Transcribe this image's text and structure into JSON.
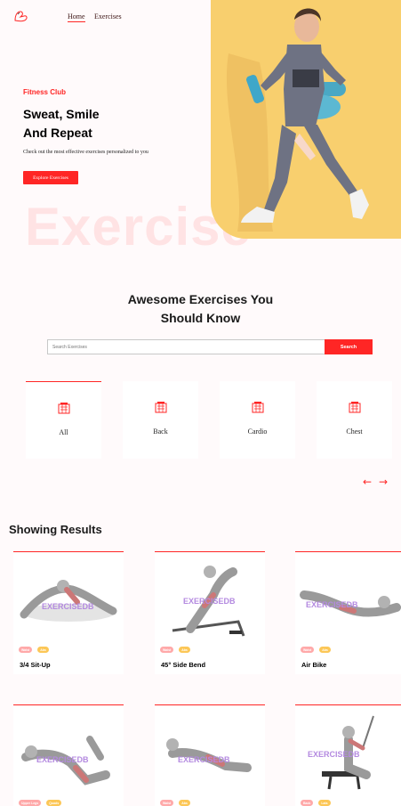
{
  "nav": {
    "home": "Home",
    "exercises": "Exercises"
  },
  "hero": {
    "tag": "Fitness Club",
    "title_line1": "Sweat, Smile",
    "title_line2": "And Repeat",
    "subtitle": "Check out the most effective exercises personalized to you",
    "button": "Explore Exercises",
    "watermark": "Exercise"
  },
  "search": {
    "title_line1": "Awesome Exercises You",
    "title_line2": "Should Know",
    "placeholder": "Search Exercises",
    "button": "Search"
  },
  "categories": [
    {
      "label": "All"
    },
    {
      "label": "Back"
    },
    {
      "label": "Cardio"
    },
    {
      "label": "Chest"
    }
  ],
  "results": {
    "title": "Showing Results",
    "watermark_text": "EXERCISEDB",
    "cards": [
      {
        "name": "3/4 Sit-Up",
        "body_part": "Waist",
        "target": "Abs"
      },
      {
        "name": "45° Side Bend",
        "body_part": "Waist",
        "target": "Abs"
      },
      {
        "name": "Air Bike",
        "body_part": "Waist",
        "target": "Abs"
      },
      {
        "name": "",
        "body_part": "Upper Legs",
        "target": "Quads"
      },
      {
        "name": "",
        "body_part": "Waist",
        "target": "Abs"
      },
      {
        "name": "",
        "body_part": "Back",
        "target": "Lats"
      }
    ]
  },
  "colors": {
    "accent": "#ff2625",
    "banner": "#f8cf6e",
    "body_pill": "#ffa9a9",
    "target_pill": "#fcc757",
    "page_bg": "#fffafb"
  }
}
